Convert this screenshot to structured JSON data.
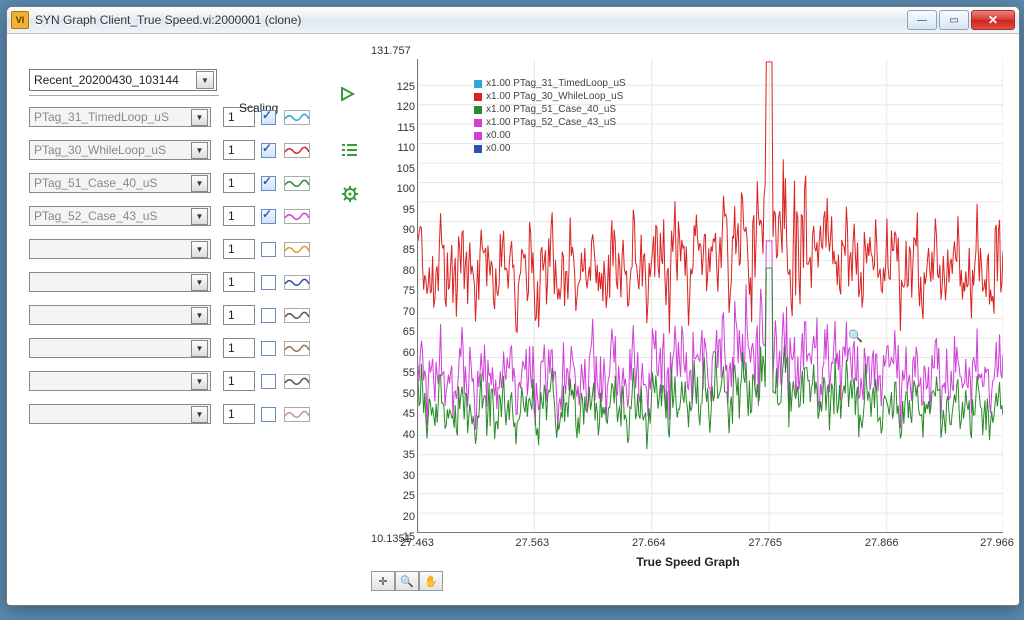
{
  "window": {
    "title": "SYN Graph Client_True Speed.vi:2000001 (clone)"
  },
  "recent": {
    "value": "Recent_20200430_103144"
  },
  "scaling_label": "Scaling",
  "rows": [
    {
      "tag": "PTag_31_TimedLoop_uS",
      "scale": "1",
      "checked": true,
      "color": "#2aa8d8"
    },
    {
      "tag": "PTag_30_WhileLoop_uS",
      "scale": "1",
      "checked": true,
      "color": "#d22"
    },
    {
      "tag": "PTag_51_Case_40_uS",
      "scale": "1",
      "checked": true,
      "color": "#2a8a2a"
    },
    {
      "tag": "PTag_52_Case_43_uS",
      "scale": "1",
      "checked": true,
      "color": "#d040d8"
    },
    {
      "tag": "",
      "scale": "1",
      "checked": false,
      "color": "#d8a020"
    },
    {
      "tag": "",
      "scale": "1",
      "checked": false,
      "color": "#3050b0"
    },
    {
      "tag": "",
      "scale": "1",
      "checked": false,
      "color": "#555"
    },
    {
      "tag": "",
      "scale": "1",
      "checked": false,
      "color": "#8a7a40"
    },
    {
      "tag": "",
      "scale": "1",
      "checked": false,
      "color": "#555"
    },
    {
      "tag": "",
      "scale": "1",
      "checked": false,
      "color": "#c890a0"
    }
  ],
  "legend": [
    {
      "label": "x1.00  PTag_31_TimedLoop_uS",
      "color": "#2aa8d8"
    },
    {
      "label": "x1.00  PTag_30_WhileLoop_uS",
      "color": "#d22"
    },
    {
      "label": "x1.00  PTag_51_Case_40_uS",
      "color": "#2a8a2a"
    },
    {
      "label": "x1.00  PTag_52_Case_43_uS",
      "color": "#d040d8"
    },
    {
      "label": "x0.00",
      "color": "#d040d8"
    },
    {
      "label": "x0.00",
      "color": "#3050b0"
    }
  ],
  "chart_data": {
    "type": "line",
    "title": "True Speed Graph",
    "xlabel": "True Speed Graph",
    "ylabel": "",
    "xlim": [
      27.463,
      27.966
    ],
    "ylim": [
      10.1351,
      131.757
    ],
    "yticks": [
      15,
      20,
      25,
      30,
      35,
      40,
      45,
      50,
      55,
      60,
      65,
      70,
      75,
      80,
      85,
      90,
      95,
      100,
      105,
      110,
      115,
      120,
      125
    ],
    "xticks": [
      27.463,
      27.563,
      27.664,
      27.765,
      27.866,
      27.966
    ],
    "ymax_label": "131.757",
    "ymin_label": "10.1351",
    "series": [
      {
        "name": "PTag_30_WhileLoop_uS",
        "color": "#d22",
        "mean": 77,
        "amp": 12,
        "spike_x": 27.765,
        "spike_y": 131
      },
      {
        "name": "PTag_52_Case_43_uS",
        "color": "#d040d8",
        "mean": 50,
        "amp": 10,
        "spike_x": 27.765,
        "spike_y": 85
      },
      {
        "name": "PTag_51_Case_40_uS",
        "color": "#2a8a2a",
        "mean": 42,
        "amp": 8,
        "spike_x": 27.765,
        "spike_y": 78
      }
    ]
  },
  "toolbar": [
    "✛",
    "🔍",
    "✋"
  ]
}
